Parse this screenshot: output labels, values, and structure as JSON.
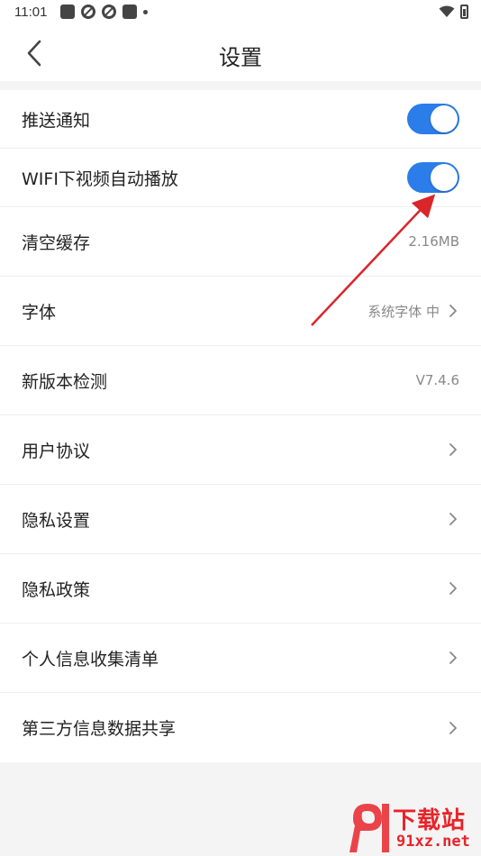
{
  "status_bar": {
    "time": "11:01"
  },
  "header": {
    "title": "设置"
  },
  "settings": [
    {
      "label": "推送通知",
      "type": "toggle",
      "on": true
    },
    {
      "label": "WIFI下视频自动播放",
      "type": "toggle",
      "on": true
    },
    {
      "label": "清空缓存",
      "type": "value",
      "value": "2.16MB"
    },
    {
      "label": "字体",
      "type": "value-chevron",
      "value": "系统字体 中"
    },
    {
      "label": "新版本检测",
      "type": "value",
      "value": "V7.4.6"
    },
    {
      "label": "用户协议",
      "type": "chevron"
    },
    {
      "label": "隐私设置",
      "type": "chevron"
    },
    {
      "label": "隐私政策",
      "type": "chevron"
    },
    {
      "label": "个人信息收集清单",
      "type": "chevron"
    },
    {
      "label": "第三方信息数据共享",
      "type": "chevron"
    }
  ],
  "watermark": {
    "brand": "下载站",
    "domain": "91xz.net"
  },
  "colors": {
    "accent": "#2b7de9",
    "annotation_arrow": "#d9262b",
    "watermark": "#e8232a"
  }
}
